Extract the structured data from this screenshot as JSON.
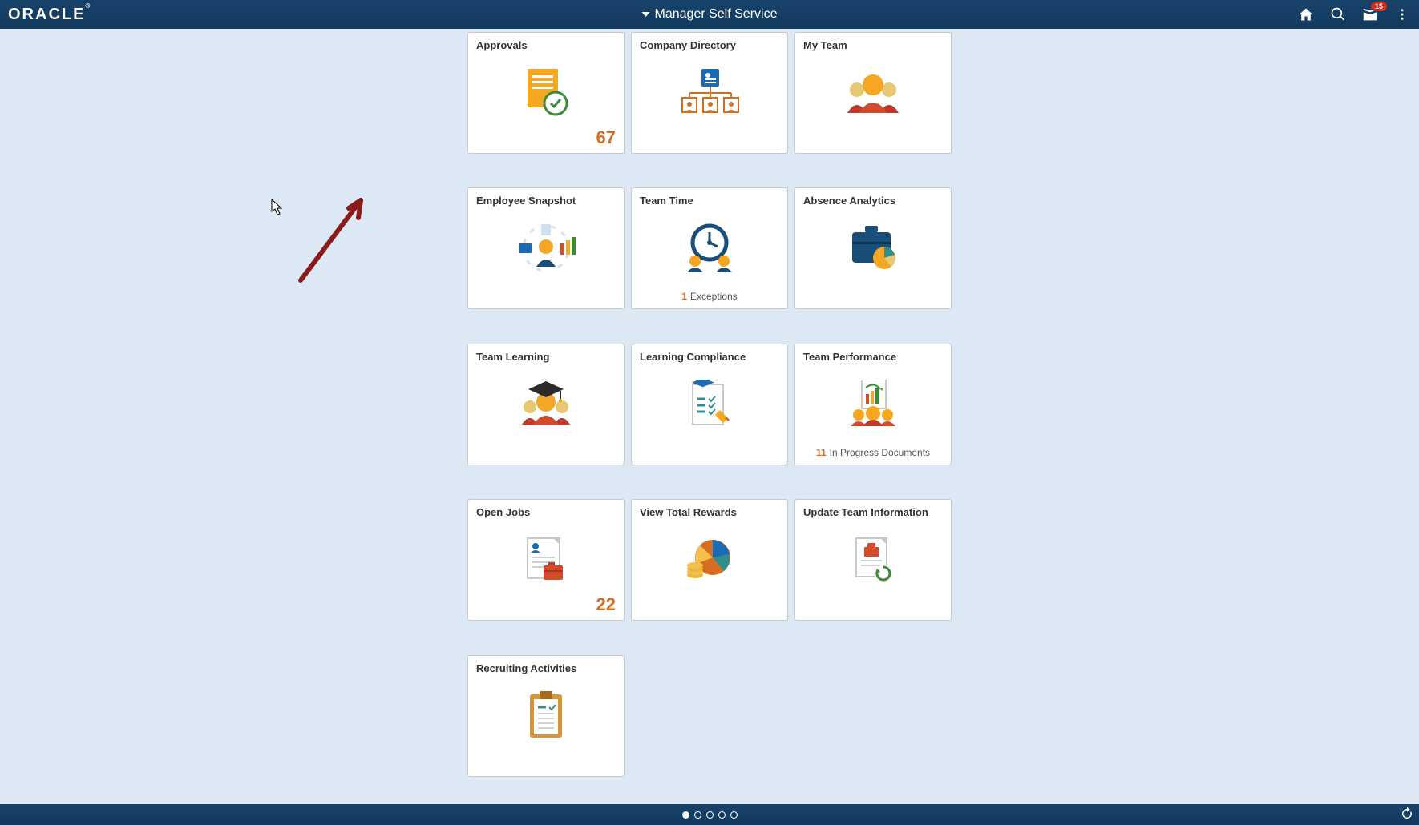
{
  "header": {
    "logo": "ORACLE",
    "title": "Manager Self Service",
    "notifications_badge": "15"
  },
  "tiles": [
    {
      "title": "Approvals",
      "count_br": "67",
      "label_bottom_num": "",
      "label_bottom_text": ""
    },
    {
      "title": "Company Directory",
      "count_br": "",
      "label_bottom_num": "",
      "label_bottom_text": ""
    },
    {
      "title": "My Team",
      "count_br": "",
      "label_bottom_num": "",
      "label_bottom_text": ""
    },
    {
      "title": "Employee Snapshot",
      "count_br": "",
      "label_bottom_num": "",
      "label_bottom_text": ""
    },
    {
      "title": "Team Time",
      "count_br": "",
      "label_bottom_num": "1",
      "label_bottom_text": "Exceptions"
    },
    {
      "title": "Absence Analytics",
      "count_br": "",
      "label_bottom_num": "",
      "label_bottom_text": ""
    },
    {
      "title": "Team Learning",
      "count_br": "",
      "label_bottom_num": "",
      "label_bottom_text": ""
    },
    {
      "title": "Learning Compliance",
      "count_br": "",
      "label_bottom_num": "",
      "label_bottom_text": ""
    },
    {
      "title": "Team Performance",
      "count_br": "",
      "label_bottom_num": "11",
      "label_bottom_text": "In Progress Documents"
    },
    {
      "title": "Open Jobs",
      "count_br": "22",
      "label_bottom_num": "",
      "label_bottom_text": ""
    },
    {
      "title": "View Total Rewards",
      "count_br": "",
      "label_bottom_num": "",
      "label_bottom_text": ""
    },
    {
      "title": "Update Team Information",
      "count_br": "",
      "label_bottom_num": "",
      "label_bottom_text": ""
    },
    {
      "title": "Recruiting Activities",
      "count_br": "",
      "label_bottom_num": "",
      "label_bottom_text": ""
    }
  ],
  "footer": {
    "dot_count": 5,
    "active_dot": 0
  }
}
